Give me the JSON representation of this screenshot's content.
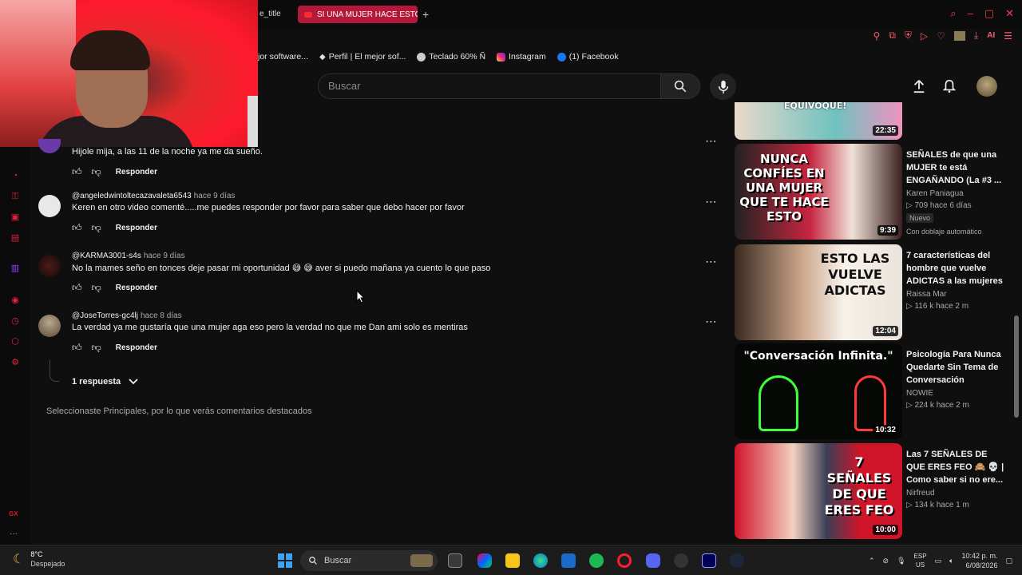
{
  "browser": {
    "tab_partial_title": "e_title",
    "active_tab_title": "SI UNA MUJER HACE ESTO",
    "new_tab_symbol": "+",
    "bookmarks": [
      {
        "label": "jor software...",
        "icon": "generic-icon",
        "color": "#666666"
      },
      {
        "label": "Perfil | El mejor sof...",
        "icon": "diamond-icon",
        "color": "#dddddd"
      },
      {
        "label": "Teclado 60% Ñ",
        "icon": "keyboard-site-icon",
        "color": "#cccccc"
      },
      {
        "label": "Instagram",
        "icon": "instagram-icon",
        "color": "#e1306c"
      },
      {
        "label": "(1) Facebook",
        "icon": "facebook-icon",
        "color": "#1877f2"
      }
    ],
    "toolbar_ai_label": "AI"
  },
  "youtube": {
    "search_placeholder": "Buscar"
  },
  "comments": [
    {
      "author": "",
      "time": "",
      "text": "Hijole mija, a las 11 de la noche ya me da sueño.",
      "reply_label": "Responder",
      "avatar_color": "#6a3aa8"
    },
    {
      "author": "@angeledwintoltecazavaleta6543",
      "time": "hace 9 días",
      "text": "Keren en otro video comenté.....me puedes responder por favor para saber que debo hacer por favor",
      "reply_label": "Responder",
      "avatar_color": "#e8e8e8"
    },
    {
      "author": "@KARMA3001-s4s",
      "time": "hace 9 días",
      "text": "No la mames seño en tonces deje pasar mi oportunidad 😅 😅 aver si puedo mañana ya cuento lo que paso",
      "reply_label": "Responder",
      "avatar_color": "#3a1414"
    },
    {
      "author": "@JoseTorres-gc4lj",
      "time": "hace 8 días",
      "text": "La verdad  ya me gustaría  que una mujer  aga eso pero la verdad  no que me Dan ami solo es mentiras",
      "reply_label": "Responder",
      "avatar_color": "#8a7a66"
    }
  ],
  "replies_toggle": "1 respuesta",
  "sort_note": "Seleccionaste Principales, por lo que verás comentarios destacados",
  "recommendations": [
    {
      "thumb_text": "EQUIVOQUE!",
      "duration": "22:35",
      "title": "",
      "channel": "",
      "meta": "",
      "badge": "",
      "dub": ""
    },
    {
      "thumb_text": "NUNCA CONFÍES EN UNA MUJER QUE TE HACE ESTO",
      "duration": "9:39",
      "title": "SEÑALES de que una MUJER te está ENGAÑANDO (La #3 ...",
      "channel": "Karen Paniagua",
      "meta": "▷ 709  hace 6 días",
      "badge": "Nuevo",
      "dub": "Con doblaje automático"
    },
    {
      "thumb_text": "ESTO LAS VUELVE ADICTAS",
      "duration": "12:04",
      "title": "7 características del hombre que vuelve ADICTAS a las mujeres",
      "channel": "Raissa Mar",
      "meta": "▷ 116 k  hace 2 m",
      "badge": "",
      "dub": ""
    },
    {
      "thumb_text": "\"Conversación Infinita.\"",
      "duration": "10:32",
      "title": "Psicología Para Nunca Quedarte Sin Tema de Conversación",
      "channel": "NOWIE",
      "meta": "▷ 224 k  hace 2 m",
      "badge": "",
      "dub": ""
    },
    {
      "thumb_text": "7 SEÑALES DE QUE ERES FEO",
      "duration": "10:00",
      "title": "Las 7 SEÑALES DE QUE ERES FEO 🙈 💀 | Como saber si no ere...",
      "channel": "Nirfreud",
      "meta": "▷ 134 k  hace 1 m",
      "badge": "",
      "dub": ""
    }
  ],
  "taskbar": {
    "weather_temp": "8°C",
    "weather_desc": "Despejado",
    "search_label": "Buscar",
    "lang_line1": "ESP",
    "lang_line2": "US",
    "time": "10:42 p. m.",
    "date": "6/08/2026"
  },
  "colors": {
    "accent_red": "#ff2a3d",
    "tab_active": "#b4183a",
    "background": "#0f0f0f"
  }
}
